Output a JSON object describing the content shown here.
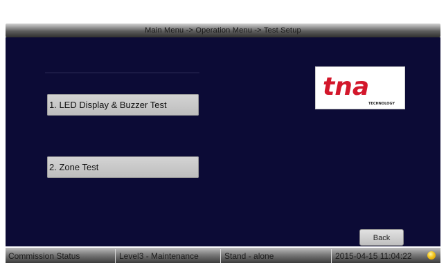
{
  "header": {
    "breadcrumb": "Main Menu -> Operation Menu -> Test Setup"
  },
  "menu": {
    "items": [
      {
        "label": "1. LED Display & Buzzer Test"
      },
      {
        "label": "2. Zone Test"
      }
    ]
  },
  "logo": {
    "brand_text": "tna",
    "tagline": "TECHNOLOGY",
    "brand_color": "#d3172b"
  },
  "actions": {
    "back_label": "Back"
  },
  "status_bar": {
    "commission": "Commission Status",
    "level": "Level3 - Maintenance",
    "mode": "Stand - alone",
    "datetime": "2015-04-15 11:04:22",
    "indicator_color": "#f3c51c"
  },
  "colors": {
    "background": "#0c0b36",
    "button_face": "#c8c8c8"
  }
}
